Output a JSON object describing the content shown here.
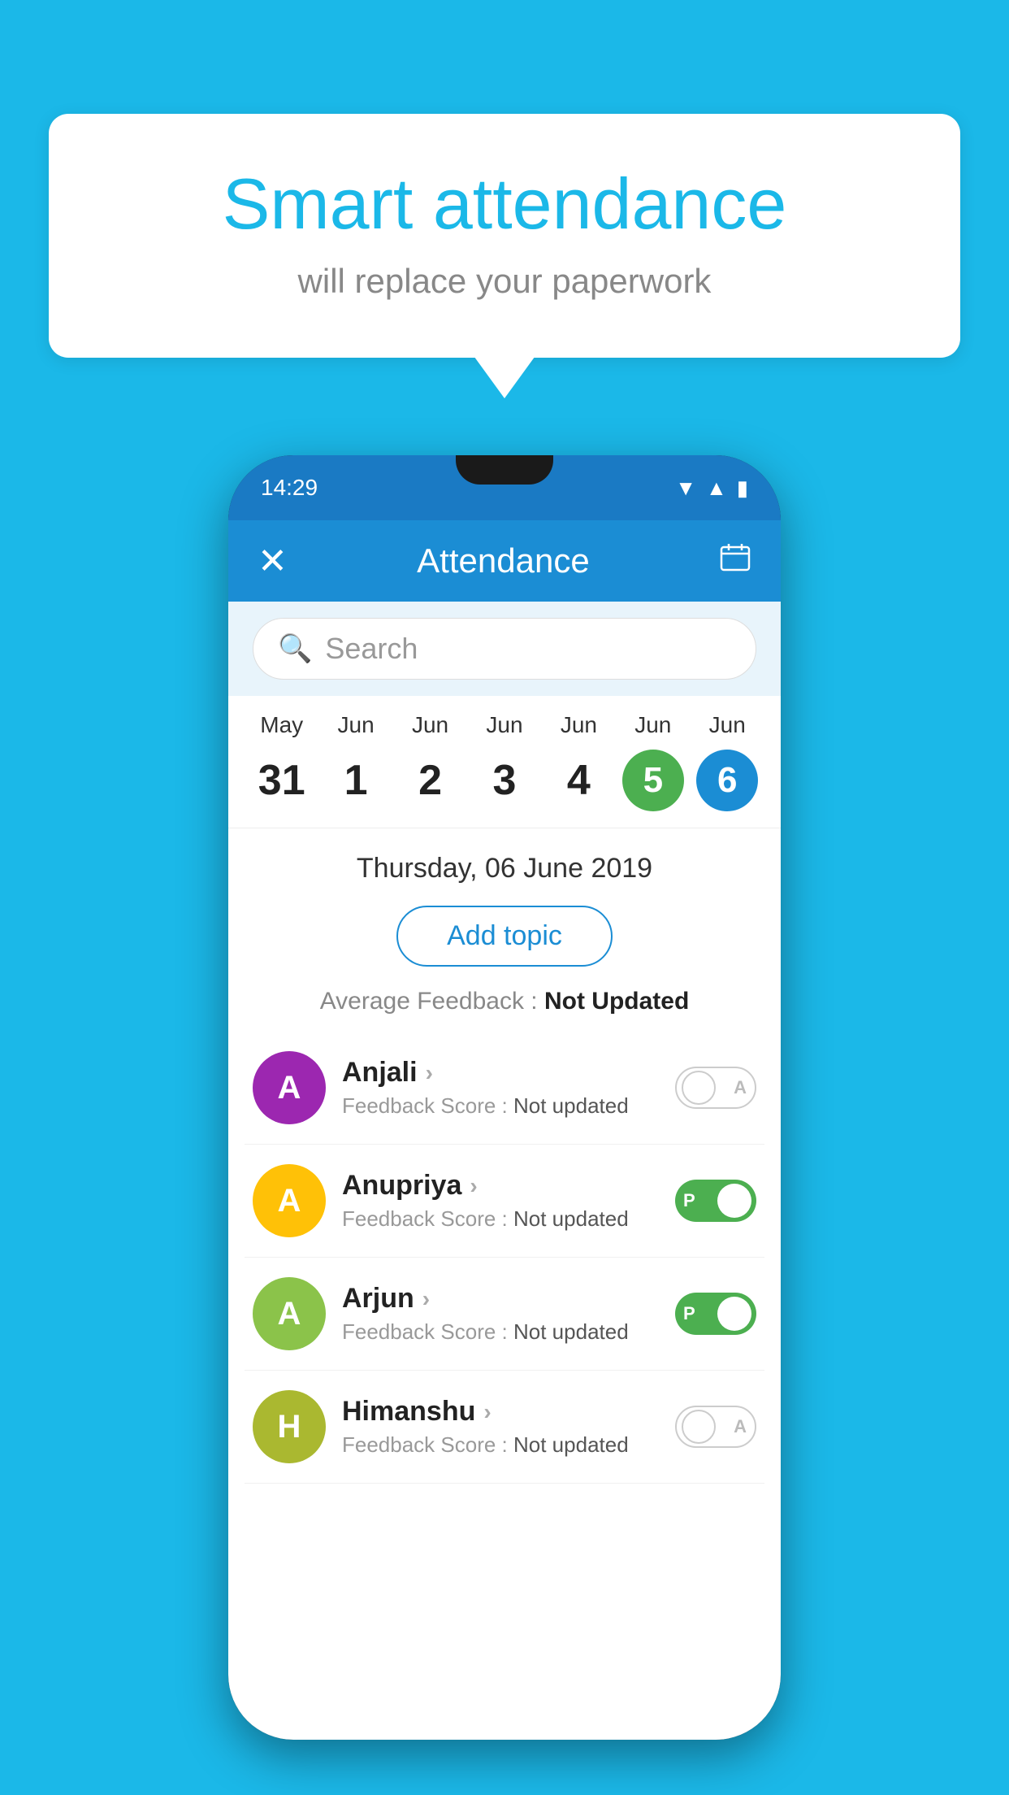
{
  "background_color": "#1bb8e8",
  "bubble": {
    "title": "Smart attendance",
    "subtitle": "will replace your paperwork"
  },
  "status_bar": {
    "time": "14:29",
    "icons": [
      "wifi",
      "signal",
      "battery"
    ]
  },
  "app_header": {
    "close_label": "✕",
    "title": "Attendance",
    "calendar_icon": "📅"
  },
  "search": {
    "placeholder": "Search"
  },
  "calendar": {
    "days": [
      {
        "month": "May",
        "date": "31",
        "highlight": "none"
      },
      {
        "month": "Jun",
        "date": "1",
        "highlight": "none"
      },
      {
        "month": "Jun",
        "date": "2",
        "highlight": "none"
      },
      {
        "month": "Jun",
        "date": "3",
        "highlight": "none"
      },
      {
        "month": "Jun",
        "date": "4",
        "highlight": "none"
      },
      {
        "month": "Jun",
        "date": "5",
        "highlight": "green"
      },
      {
        "month": "Jun",
        "date": "6",
        "highlight": "blue"
      }
    ]
  },
  "selected_date": "Thursday, 06 June 2019",
  "add_topic_label": "Add topic",
  "average_feedback": {
    "label": "Average Feedback : ",
    "value": "Not Updated"
  },
  "students": [
    {
      "name": "Anjali",
      "avatar_letter": "A",
      "avatar_color": "purple",
      "feedback_label": "Feedback Score : ",
      "feedback_value": "Not updated",
      "attendance": "off",
      "toggle_label": "A"
    },
    {
      "name": "Anupriya",
      "avatar_letter": "A",
      "avatar_color": "yellow",
      "feedback_label": "Feedback Score : ",
      "feedback_value": "Not updated",
      "attendance": "on",
      "toggle_label": "P"
    },
    {
      "name": "Arjun",
      "avatar_letter": "A",
      "avatar_color": "green-light",
      "feedback_label": "Feedback Score : ",
      "feedback_value": "Not updated",
      "attendance": "on",
      "toggle_label": "P"
    },
    {
      "name": "Himanshu",
      "avatar_letter": "H",
      "avatar_color": "olive",
      "feedback_label": "Feedback Score : ",
      "feedback_value": "Not updated",
      "attendance": "off",
      "toggle_label": "A"
    }
  ]
}
